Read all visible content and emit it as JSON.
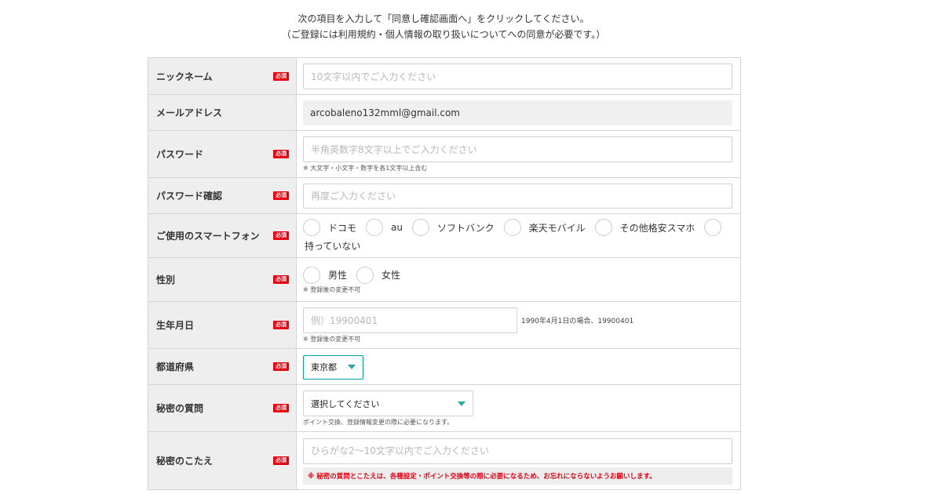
{
  "intro": {
    "line1": "次の項目を入力して「同意し確認画面へ」をクリックしてください。",
    "line2": "（ご登録には利用規約・個人情報の取り扱いについてへの同意が必要です。）"
  },
  "required_badge": "必須",
  "fields": {
    "nickname": {
      "label": "ニックネーム",
      "placeholder": "10文字以内でご入力ください"
    },
    "email": {
      "label": "メールアドレス",
      "value": "arcobaleno132mml@gmail.com"
    },
    "password": {
      "label": "パスワード",
      "placeholder": "半角英数字8文字以上でご入力ください",
      "note": "※ 大文字・小文字・数字を各1文字以上含む"
    },
    "password_confirm": {
      "label": "パスワード確認",
      "placeholder": "再度ご入力ください"
    },
    "smartphone": {
      "label": "ご使用のスマートフォン",
      "options": [
        "ドコモ",
        "au",
        "ソフトバンク",
        "楽天モバイル",
        "その他格安スマホ",
        "持っていない"
      ]
    },
    "gender": {
      "label": "性別",
      "options": [
        "男性",
        "女性"
      ],
      "note": "※ 登録後の変更不可"
    },
    "birthday": {
      "label": "生年月日",
      "placeholder": "例）19900401",
      "hint": "1990年4月1日の場合、19900401",
      "note": "※ 登録後の変更不可"
    },
    "prefecture": {
      "label": "都道府県",
      "selected": "東京都"
    },
    "secret_question": {
      "label": "秘密の質問",
      "selected": "選択してください",
      "note": "ポイント交換、登録情報変更の際に必要になります。"
    },
    "secret_answer": {
      "label": "秘密のこたえ",
      "placeholder": "ひらがな2〜10文字以内でご入力ください",
      "alert": "※ 秘密の質問とこたえは、各種設定・ポイント交換等の際に必要になるため、お忘れにならないようお願いします。"
    }
  },
  "colors": {
    "required": "#e60012",
    "label_bg": "#eeeeee",
    "accent": "#2aa5a0"
  }
}
